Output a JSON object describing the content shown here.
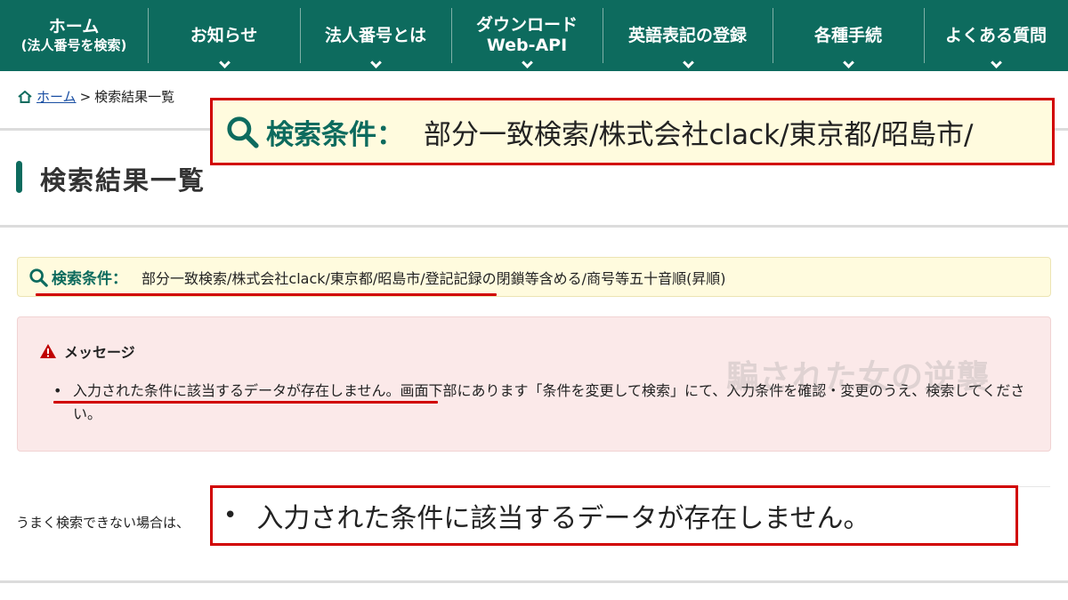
{
  "nav": {
    "home_line1": "ホーム",
    "home_line2": "(法人番号を検索)",
    "items": [
      {
        "label": "お知らせ"
      },
      {
        "label": "法人番号とは"
      },
      {
        "label1": "ダウンロード",
        "label2": "Web-API"
      },
      {
        "label": "英語表記の登録"
      },
      {
        "label": "各種手続"
      },
      {
        "label": "よくある質問"
      }
    ]
  },
  "breadcrumb": {
    "home": "ホーム",
    "separator": ">",
    "current": "検索結果一覧"
  },
  "page_title": "検索結果一覧",
  "search_condition": {
    "label": "検索条件：",
    "text": "部分一致検索/株式会社clack/東京都/昭島市/登記記録の閉鎖等含める/商号等五十音順(昇順)"
  },
  "message": {
    "title": "メッセージ",
    "items": [
      "入力された条件に該当するデータが存在しません。画面下部にあります「条件を変更して検索」にて、入力条件を確認・変更のうえ、検索してください。"
    ]
  },
  "tip_text": "うまく検索できない場合は、",
  "watermark": "騙された女の逆襲",
  "zoom_condition": {
    "label": "検索条件：",
    "text": "部分一致検索/株式会社clack/東京都/昭島市/"
  },
  "zoom_message": {
    "bullet": "•",
    "text": "入力された条件に該当するデータが存在しません。"
  },
  "colors": {
    "brand_green": "#0d6b5e",
    "annotation_red": "#d10000",
    "condition_bg": "#fffbde",
    "message_bg": "#fbe9e9"
  }
}
